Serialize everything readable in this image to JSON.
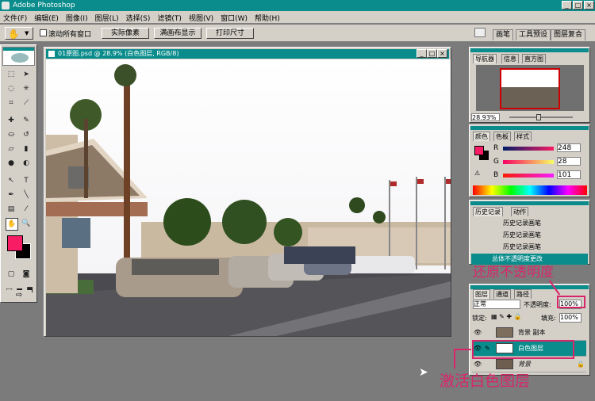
{
  "app": {
    "title": "Adobe Photoshop"
  },
  "menu": [
    "文件(F)",
    "编辑(E)",
    "图像(I)",
    "图层(L)",
    "选择(S)",
    "滤镜(T)",
    "视图(V)",
    "窗口(W)",
    "帮助(H)"
  ],
  "options": {
    "checkbox_label": "滚动所有窗口",
    "btn_actual": "实际像素",
    "btn_fit": "满画布显示",
    "btn_print": "打印尺寸"
  },
  "palette_well": {
    "tabs": [
      "画笔",
      "工具预设",
      "图层复合"
    ]
  },
  "document": {
    "title": "01原图.psd @ 28.9% (白色图层, RGB/8)"
  },
  "navigator": {
    "tabs": [
      "导航器",
      "信息",
      "直方图"
    ],
    "zoom": "28.93%"
  },
  "color": {
    "tabs": [
      "颜色",
      "色板",
      "样式"
    ],
    "channels": [
      {
        "label": "R",
        "value": "248"
      },
      {
        "label": "G",
        "value": "28"
      },
      {
        "label": "B",
        "value": "101"
      }
    ],
    "fg_color": "#f81c65"
  },
  "history": {
    "tabs": [
      "历史记录",
      "动作"
    ],
    "items": [
      "历史记录画笔",
      "历史记录画笔",
      "历史记录画笔",
      "总体不透明度更改"
    ],
    "active_index": 3
  },
  "layers": {
    "tabs": [
      "图层",
      "通道",
      "路径"
    ],
    "blend_mode": "正常",
    "opacity_label": "不透明度:",
    "opacity": "100%",
    "lock_label": "锁定:",
    "fill_label": "填充:",
    "fill": "100%",
    "items": [
      {
        "name": "背景 副本",
        "active": false
      },
      {
        "name": "白色图层",
        "active": true
      },
      {
        "name": "背景",
        "active": false
      }
    ]
  },
  "annotations": {
    "top": "还原不透明度",
    "bottom": "激活白色图层",
    "color": "#d8266a"
  }
}
